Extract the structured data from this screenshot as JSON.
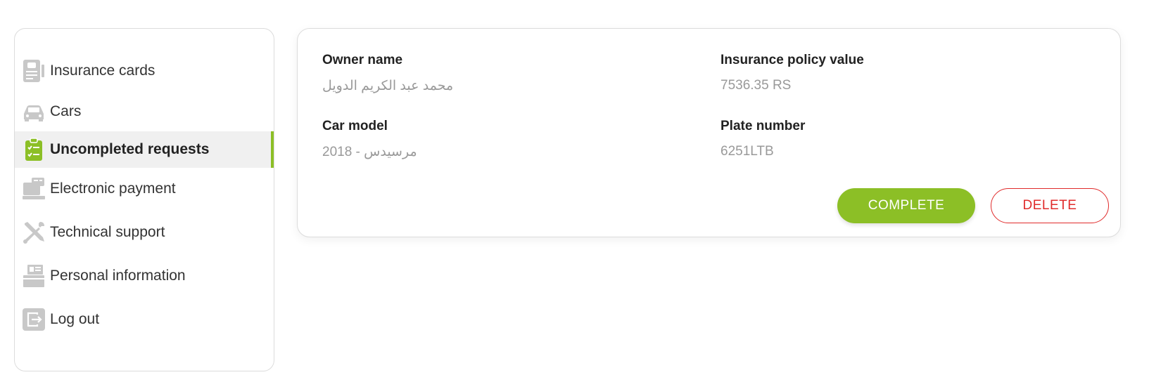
{
  "sidebar": {
    "items": [
      {
        "label": "Insurance cards",
        "icon": "insurance-card-icon",
        "active": false
      },
      {
        "label": "Cars",
        "icon": "car-icon",
        "active": false
      },
      {
        "label": "Uncompleted requests",
        "icon": "clipboard-checklist-icon",
        "active": true
      },
      {
        "label": "Electronic payment",
        "icon": "payment-terminal-icon",
        "active": false
      },
      {
        "label": "Technical support",
        "icon": "tools-icon",
        "active": false
      },
      {
        "label": "Personal information",
        "icon": "id-card-icon",
        "active": false
      },
      {
        "label": "Log out",
        "icon": "logout-icon",
        "active": false
      }
    ]
  },
  "request": {
    "owner_name_label": "Owner name",
    "owner_name_value": "محمد عبد الكريم الدويل",
    "policy_value_label": "Insurance policy value",
    "policy_value_value": "7536.35 RS",
    "car_model_label": "Car model",
    "car_model_value": "2018 - مرسيدس",
    "plate_number_label": "Plate number",
    "plate_number_value": "6251LTB",
    "complete_label": "COMPLETE",
    "delete_label": "DELETE"
  },
  "colors": {
    "accent": "#8cbf26",
    "danger": "#e02b2b",
    "muted_text": "#999999",
    "icon_gray": "#c8c8c8"
  }
}
